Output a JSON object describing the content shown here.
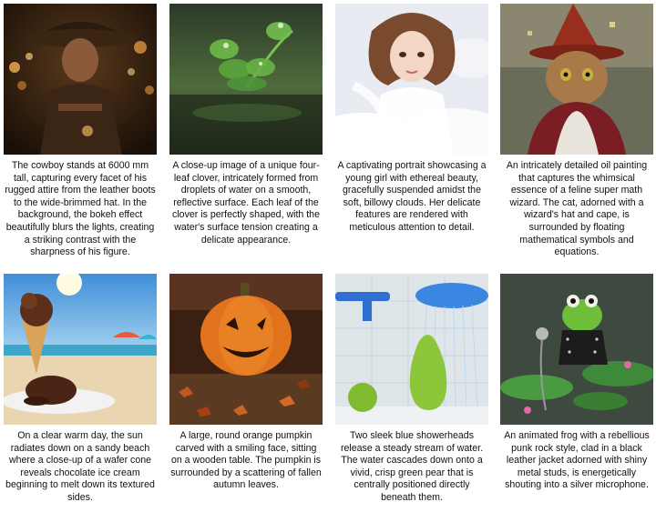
{
  "cards": [
    {
      "caption": "The cowboy stands at 6000 mm tall, capturing every facet of his rugged attire from the leather boots to the wide-brimmed hat. In the background, the bokeh effect beautifully blurs the lights, creating a striking contrast with the sharpness of his figure."
    },
    {
      "caption": "A close-up image of a unique four-leaf clover, intricately formed from droplets of water on a smooth, reflective surface. Each leaf of the clover is perfectly shaped, with the water's surface tension creating a delicate appearance."
    },
    {
      "caption": "A captivating portrait showcasing a young girl with ethereal beauty, gracefully suspended amidst the soft, billowy clouds. Her delicate features are rendered with meticulous attention to detail."
    },
    {
      "caption": "An intricately detailed oil painting that captures the whimsical essence of a feline super math wizard. The cat, adorned with a wizard's hat and cape, is surrounded by floating mathematical symbols and equations."
    },
    {
      "caption": "On a clear warm day, the sun radiates down on a sandy beach where a close-up of a wafer cone reveals chocolate ice cream beginning to melt down its textured sides."
    },
    {
      "caption": "A large, round orange pumpkin carved with a smiling face, sitting on a wooden table. The pumpkin is surrounded by a scattering of fallen autumn leaves."
    },
    {
      "caption": "Two sleek blue showerheads release a steady stream of water. The water cascades down onto a vivid, crisp green pear that is centrally positioned directly beneath them."
    },
    {
      "caption": "An animated frog with a rebellious punk rock style, clad in a black leather jacket adorned with shiny metal studs, is energetically shouting into a silver microphone."
    }
  ]
}
